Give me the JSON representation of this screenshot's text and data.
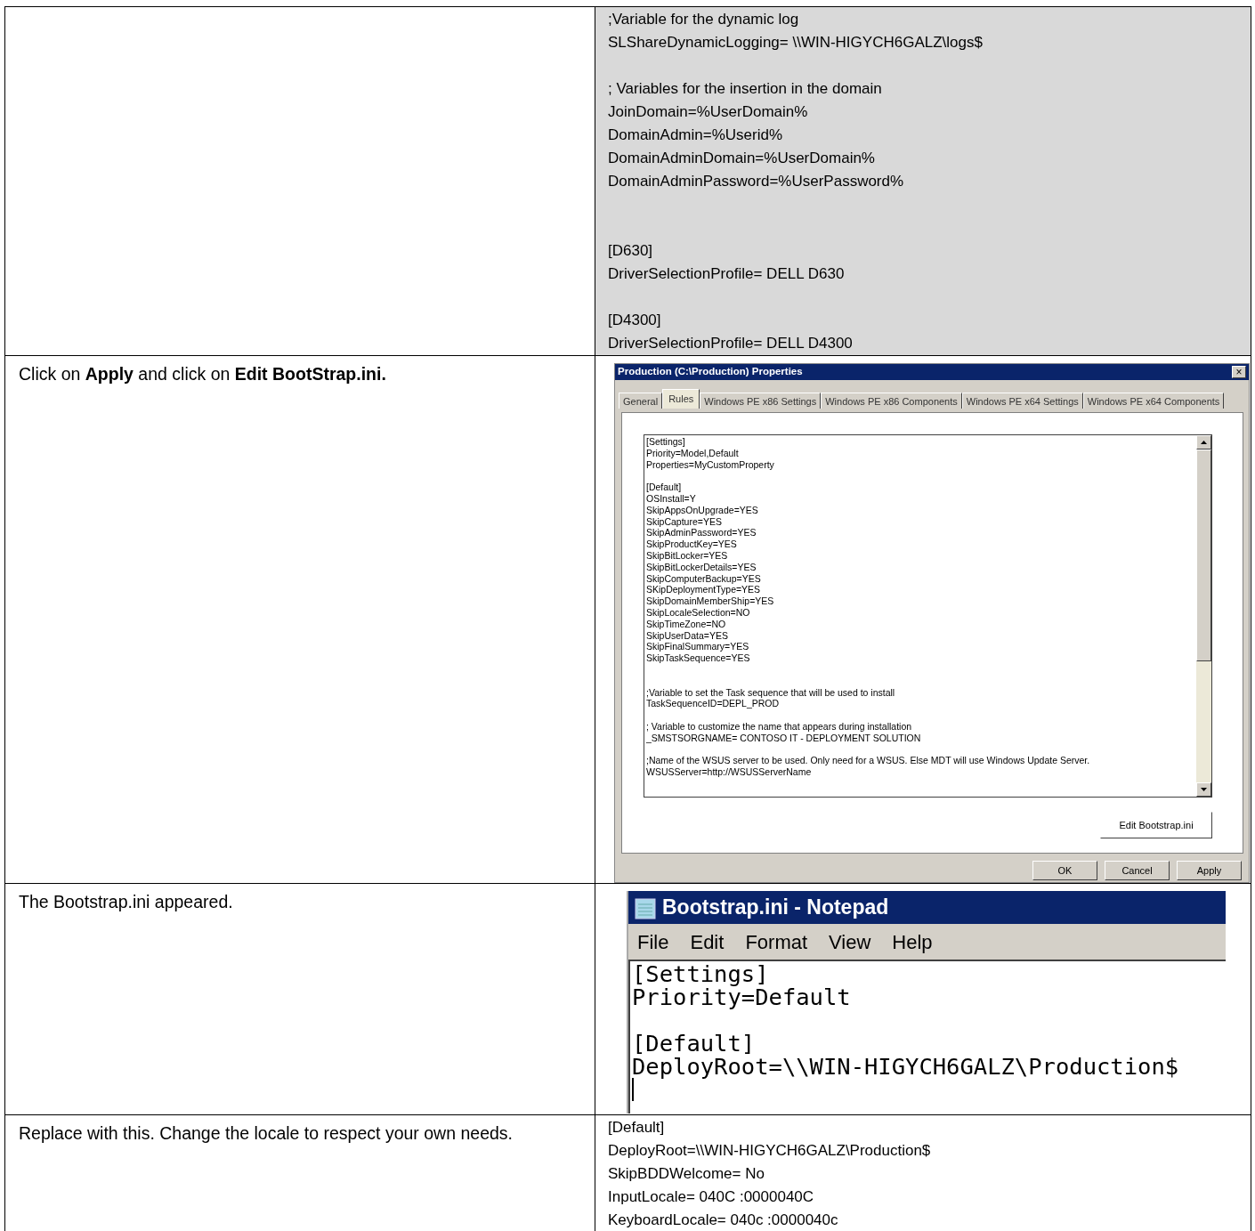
{
  "rows": [
    {
      "instruction": null,
      "content": {
        "kind": "code",
        "shaded": true,
        "blocks": [
          {
            "lines": [
              ";Variable for the dynamic log",
              "SLShareDynamicLogging= \\\\WIN-HIGYCH6GALZ\\logs$"
            ]
          },
          {
            "lines": [
              "; Variables for the insertion in the domain",
              "JoinDomain=%UserDomain%",
              "DomainAdmin=%Userid%",
              "DomainAdminDomain=%UserDomain%",
              "DomainAdminPassword=%UserPassword%"
            ]
          },
          {
            "wide_gap": true,
            "lines": [
              "[D630]",
              "DriverSelectionProfile= DELL D630"
            ]
          },
          {
            "lines": [
              "[D4300]",
              "DriverSelectionProfile= DELL D4300"
            ]
          }
        ]
      }
    },
    {
      "instruction": "Click on **Apply** and click on **Edit BootStrap.ini.**",
      "content": {
        "kind": "properties_dialog",
        "title": "Production (C:\\Production) Properties",
        "close": "×",
        "tabs": [
          {
            "label": "General",
            "selected": false
          },
          {
            "label": "Rules",
            "selected": true
          },
          {
            "label": "Windows PE x86 Settings",
            "selected": false
          },
          {
            "label": "Windows PE x86 Components",
            "selected": false
          },
          {
            "label": "Windows PE x64 Settings",
            "selected": false
          },
          {
            "label": "Windows PE x64 Components",
            "selected": false
          }
        ],
        "rules_blocks": [
          {
            "lines": [
              "[Settings]",
              "Priority=Model,Default",
              "Properties=MyCustomProperty"
            ]
          },
          {
            "lines": [
              "[Default]",
              "OSInstall=Y",
              "SkipAppsOnUpgrade=YES",
              "SkipCapture=YES",
              "SkipAdminPassword=YES",
              "SkipProductKey=YES",
              "SkipBitLocker=YES",
              "SkipBitLockerDetails=YES",
              "SkipComputerBackup=YES",
              "SKipDeploymentType=YES",
              "SkipDomainMemberShip=YES",
              "SkipLocaleSelection=NO",
              "SkipTimeZone=NO",
              "SkipUserData=YES",
              "SkipFinalSummary=YES",
              "SkipTaskSequence=YES"
            ]
          },
          {
            "wide_gap": true,
            "lines": [
              ";Variable to set the Task sequence that will be used to install",
              "TaskSequenceID=DEPL_PROD"
            ]
          },
          {
            "lines": [
              "; Variable to customize the name that appears during installation",
              "_SMSTSORGNAME= CONTOSO IT - DEPLOYMENT SOLUTION"
            ]
          },
          {
            "lines": [
              ";Name of the WSUS server to be used. Only need for a WSUS. Else MDT will use Windows Update Server.",
              "WSUSServer=http://WSUSServerName"
            ]
          }
        ],
        "edit_button": "Edit Bootstrap.ini",
        "buttons": [
          "OK",
          "Cancel",
          "Apply"
        ]
      }
    },
    {
      "instruction": "The Bootstrap.ini appeared.",
      "content": {
        "kind": "notepad",
        "title": "Bootstrap.ini - Notepad",
        "menu": [
          "File",
          "Edit",
          "Format",
          "View",
          "Help"
        ],
        "blocks": [
          {
            "lines": [
              "[Settings]",
              "Priority=Default"
            ]
          },
          {
            "lines": [
              "[Default]",
              "DeployRoot=\\\\WIN-HIGYCH6GALZ\\Production$"
            ]
          }
        ]
      }
    },
    {
      "instruction": "Replace with this. Change the locale to respect your own needs.",
      "content": {
        "kind": "code",
        "shaded": false,
        "blocks": [
          {
            "lines": [
              "[Default]",
              "DeployRoot=\\\\WIN-HIGYCH6GALZ\\Production$",
              "SkipBDDWelcome= No",
              "InputLocale= 040C :0000040C",
              "KeyboardLocale= 040c :0000040c"
            ]
          }
        ]
      }
    }
  ]
}
